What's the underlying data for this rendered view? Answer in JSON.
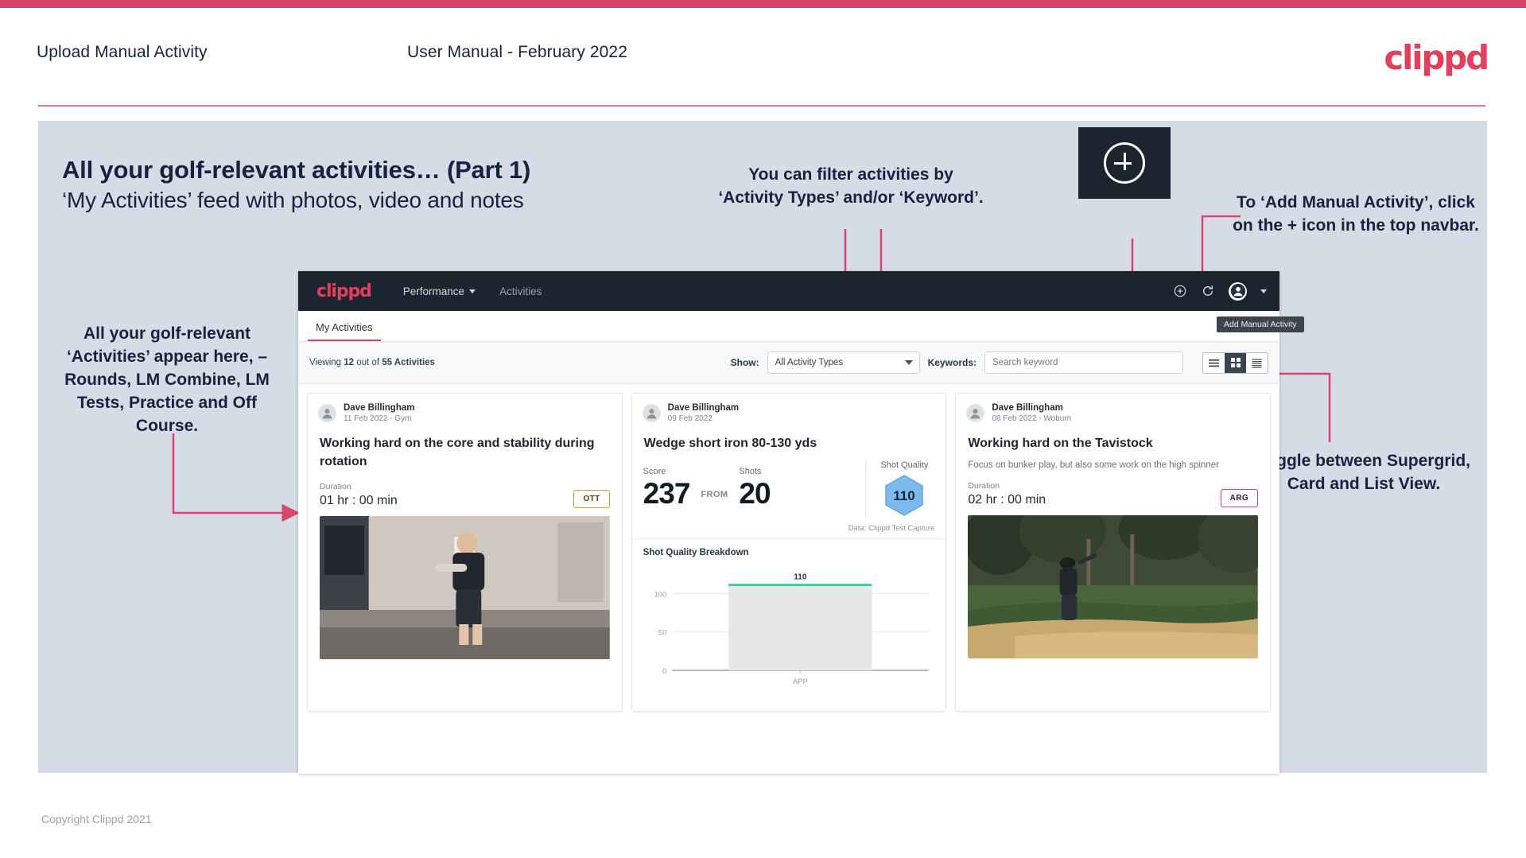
{
  "slide": {
    "header_left": "Upload Manual Activity",
    "header_center": "User Manual - February 2022",
    "logo": "clippd",
    "title": "All your golf-relevant activities… (Part 1)",
    "subtitle": "‘My Activities’ feed with photos, video and notes",
    "footer": "Copyright Clippd 2021"
  },
  "annotations": {
    "filter": "You can filter activities by ‘Activity Types’ and/or ‘Keyword’.",
    "add_manual": "To ‘Add Manual Activity’, click on the + icon in the top navbar.",
    "activities_feed": "All your golf-relevant ‘Activities’ appear here, – Rounds, LM Combine, LM Tests, Practice and Off Course.",
    "toggle_views": "Toggle between Supergrid, Card and List View."
  },
  "callout": {
    "plus_icon": "plus-circle-icon"
  },
  "app": {
    "navbar": {
      "logo": "clippd",
      "links": [
        {
          "label": "Performance",
          "has_caret": true
        },
        {
          "label": "Activities",
          "has_caret": false
        }
      ],
      "icons": [
        "plus-icon",
        "refresh-icon",
        "avatar-icon",
        "chevron-down-icon"
      ],
      "tooltip": "Add Manual Activity"
    },
    "subnav": {
      "tab": "My Activities"
    },
    "filterbar": {
      "viewing_prefix": "Viewing ",
      "viewing_count": "12",
      "viewing_mid": " out of ",
      "viewing_total": "55 Activities",
      "show_label": "Show:",
      "show_value": "All Activity Types",
      "keywords_label": "Keywords:",
      "keywords_placeholder": "Search keyword",
      "view_modes": [
        "supergrid-view",
        "card-view",
        "list-view"
      ],
      "active_view": "card-view"
    },
    "cards": [
      {
        "user": "Dave Billingham",
        "date": "11 Feb 2022 - Gym",
        "title": "Working hard on the core and stability during rotation",
        "duration_label": "Duration",
        "duration_value": "01 hr : 00 min",
        "badge": "OTT",
        "badge_color": "#c8a12a",
        "media": "gym-video-thumbnail"
      },
      {
        "user": "Dave Billingham",
        "date": "09 Feb 2022",
        "title": "Wedge short iron 80-130 yds",
        "score_label": "Score",
        "score_value": "237",
        "from_label": "FROM",
        "shots_label": "Shots",
        "shots_value": "20",
        "shot_quality_label": "Shot Quality",
        "shot_quality_value": "110",
        "data_source": "Data: Clippd Test Capture",
        "chart_title": "Shot Quality Breakdown"
      },
      {
        "user": "Dave Billingham",
        "date": "08 Feb 2022 - Woburn",
        "title": "Working hard on the Tavistock",
        "note": "Focus on bunker play, but also some work on the high spinner",
        "duration_label": "Duration",
        "duration_value": "02 hr : 00 min",
        "badge": "ARG",
        "badge_color": "#e23f5d",
        "media": "bunker-photo-thumbnail"
      }
    ]
  },
  "chart_data": {
    "type": "bar",
    "title": "Shot Quality Breakdown",
    "categories": [
      "APP"
    ],
    "values": [
      110
    ],
    "data_labels": [
      "110"
    ],
    "ylabel": "",
    "xlabel": "",
    "ylim": [
      0,
      120
    ],
    "yticks": [
      0,
      50,
      100
    ],
    "ytick_labels": [
      "0",
      "50",
      "100"
    ],
    "bar_color": "#e6e7e8",
    "cap_color": "#3bc9a0",
    "grid": true,
    "legend": "none"
  },
  "colors": {
    "accent": "#e23f5d",
    "navy": "#1c2430",
    "slide_bg": "#d6dce6",
    "arrow": "#d6456a"
  }
}
